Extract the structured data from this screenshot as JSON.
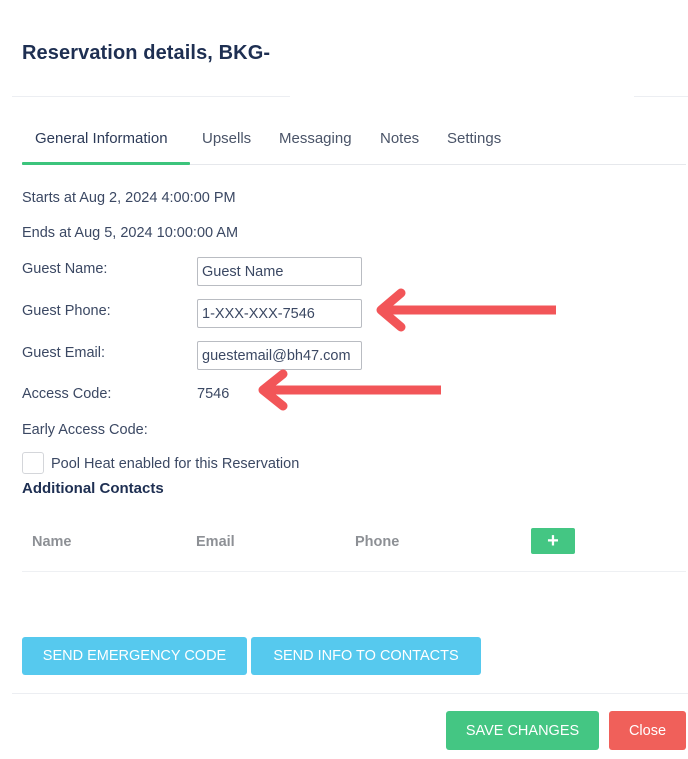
{
  "header": {
    "title": "Reservation details, BKG-"
  },
  "tabs": [
    {
      "label": "General Information",
      "active": true
    },
    {
      "label": "Upsells",
      "active": false
    },
    {
      "label": "Messaging",
      "active": false
    },
    {
      "label": "Notes",
      "active": false
    },
    {
      "label": "Settings",
      "active": false
    }
  ],
  "general": {
    "starts": "Starts at Aug 2, 2024 4:00:00 PM",
    "ends": "Ends at Aug 5, 2024 10:00:00 AM",
    "guest_name_label": "Guest Name:",
    "guest_name_value": "Guest Name",
    "guest_phone_label": "Guest Phone:",
    "guest_phone_value": "1-XXX-XXX-7546",
    "guest_email_label": "Guest Email:",
    "guest_email_value": "guestemail@bh47.com",
    "access_code_label": "Access Code:",
    "access_code_value": "7546",
    "early_access_code_label": "Early Access Code:",
    "early_access_code_value": "",
    "pool_heat_label": "Pool Heat enabled for this Reservation",
    "pool_heat_checked": false
  },
  "contacts": {
    "title": "Additional Contacts",
    "columns": [
      "Name",
      "Email",
      "Phone"
    ],
    "add_icon": "plus-icon",
    "rows": []
  },
  "actions": {
    "send_emergency_code": "SEND EMERGENCY CODE",
    "send_info_to_contacts": "SEND INFO TO CONTACTS",
    "save_changes": "SAVE CHANGES",
    "close": "Close"
  },
  "annotations": {
    "arrow_color": "#f25558",
    "arrows": [
      {
        "points_to": "guest-phone-input",
        "icon": "arrow-left-icon"
      },
      {
        "points_to": "access-code-value",
        "icon": "arrow-left-icon"
      }
    ]
  },
  "colors": {
    "tab_active_underline": "#3cc47c",
    "info_button": "#56c9ee",
    "success_button": "#44c683",
    "danger_button": "#f0605a",
    "title_text": "#1e2f52"
  }
}
